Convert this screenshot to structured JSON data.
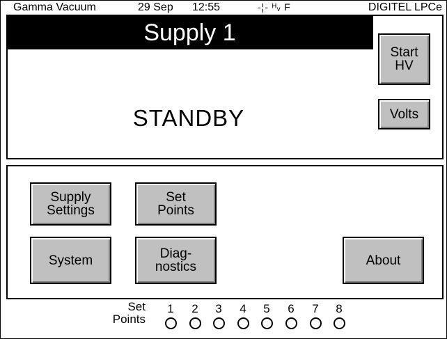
{
  "status_bar": {
    "company": "Gamma Vacuum",
    "date": "29 Sep",
    "time": "12:55",
    "flags": "-¦- ᴴᵥ F",
    "model": "DIGITEL LPCe"
  },
  "supply": {
    "title": "Supply 1",
    "state": "STANDBY"
  },
  "buttons": {
    "start_hv": "Start\nHV",
    "volts": "Volts",
    "supply_settings": "Supply\nSettings",
    "set_points": "Set\nPoints",
    "system": "System",
    "diagnostics": "Diag-\nnostics",
    "about": "About"
  },
  "setpoints": {
    "label": "Set\nPoints",
    "items": [
      {
        "number": "1",
        "state": "off"
      },
      {
        "number": "2",
        "state": "off"
      },
      {
        "number": "3",
        "state": "off"
      },
      {
        "number": "4",
        "state": "off"
      },
      {
        "number": "5",
        "state": "off"
      },
      {
        "number": "6",
        "state": "off"
      },
      {
        "number": "7",
        "state": "off"
      },
      {
        "number": "8",
        "state": "off"
      }
    ]
  }
}
